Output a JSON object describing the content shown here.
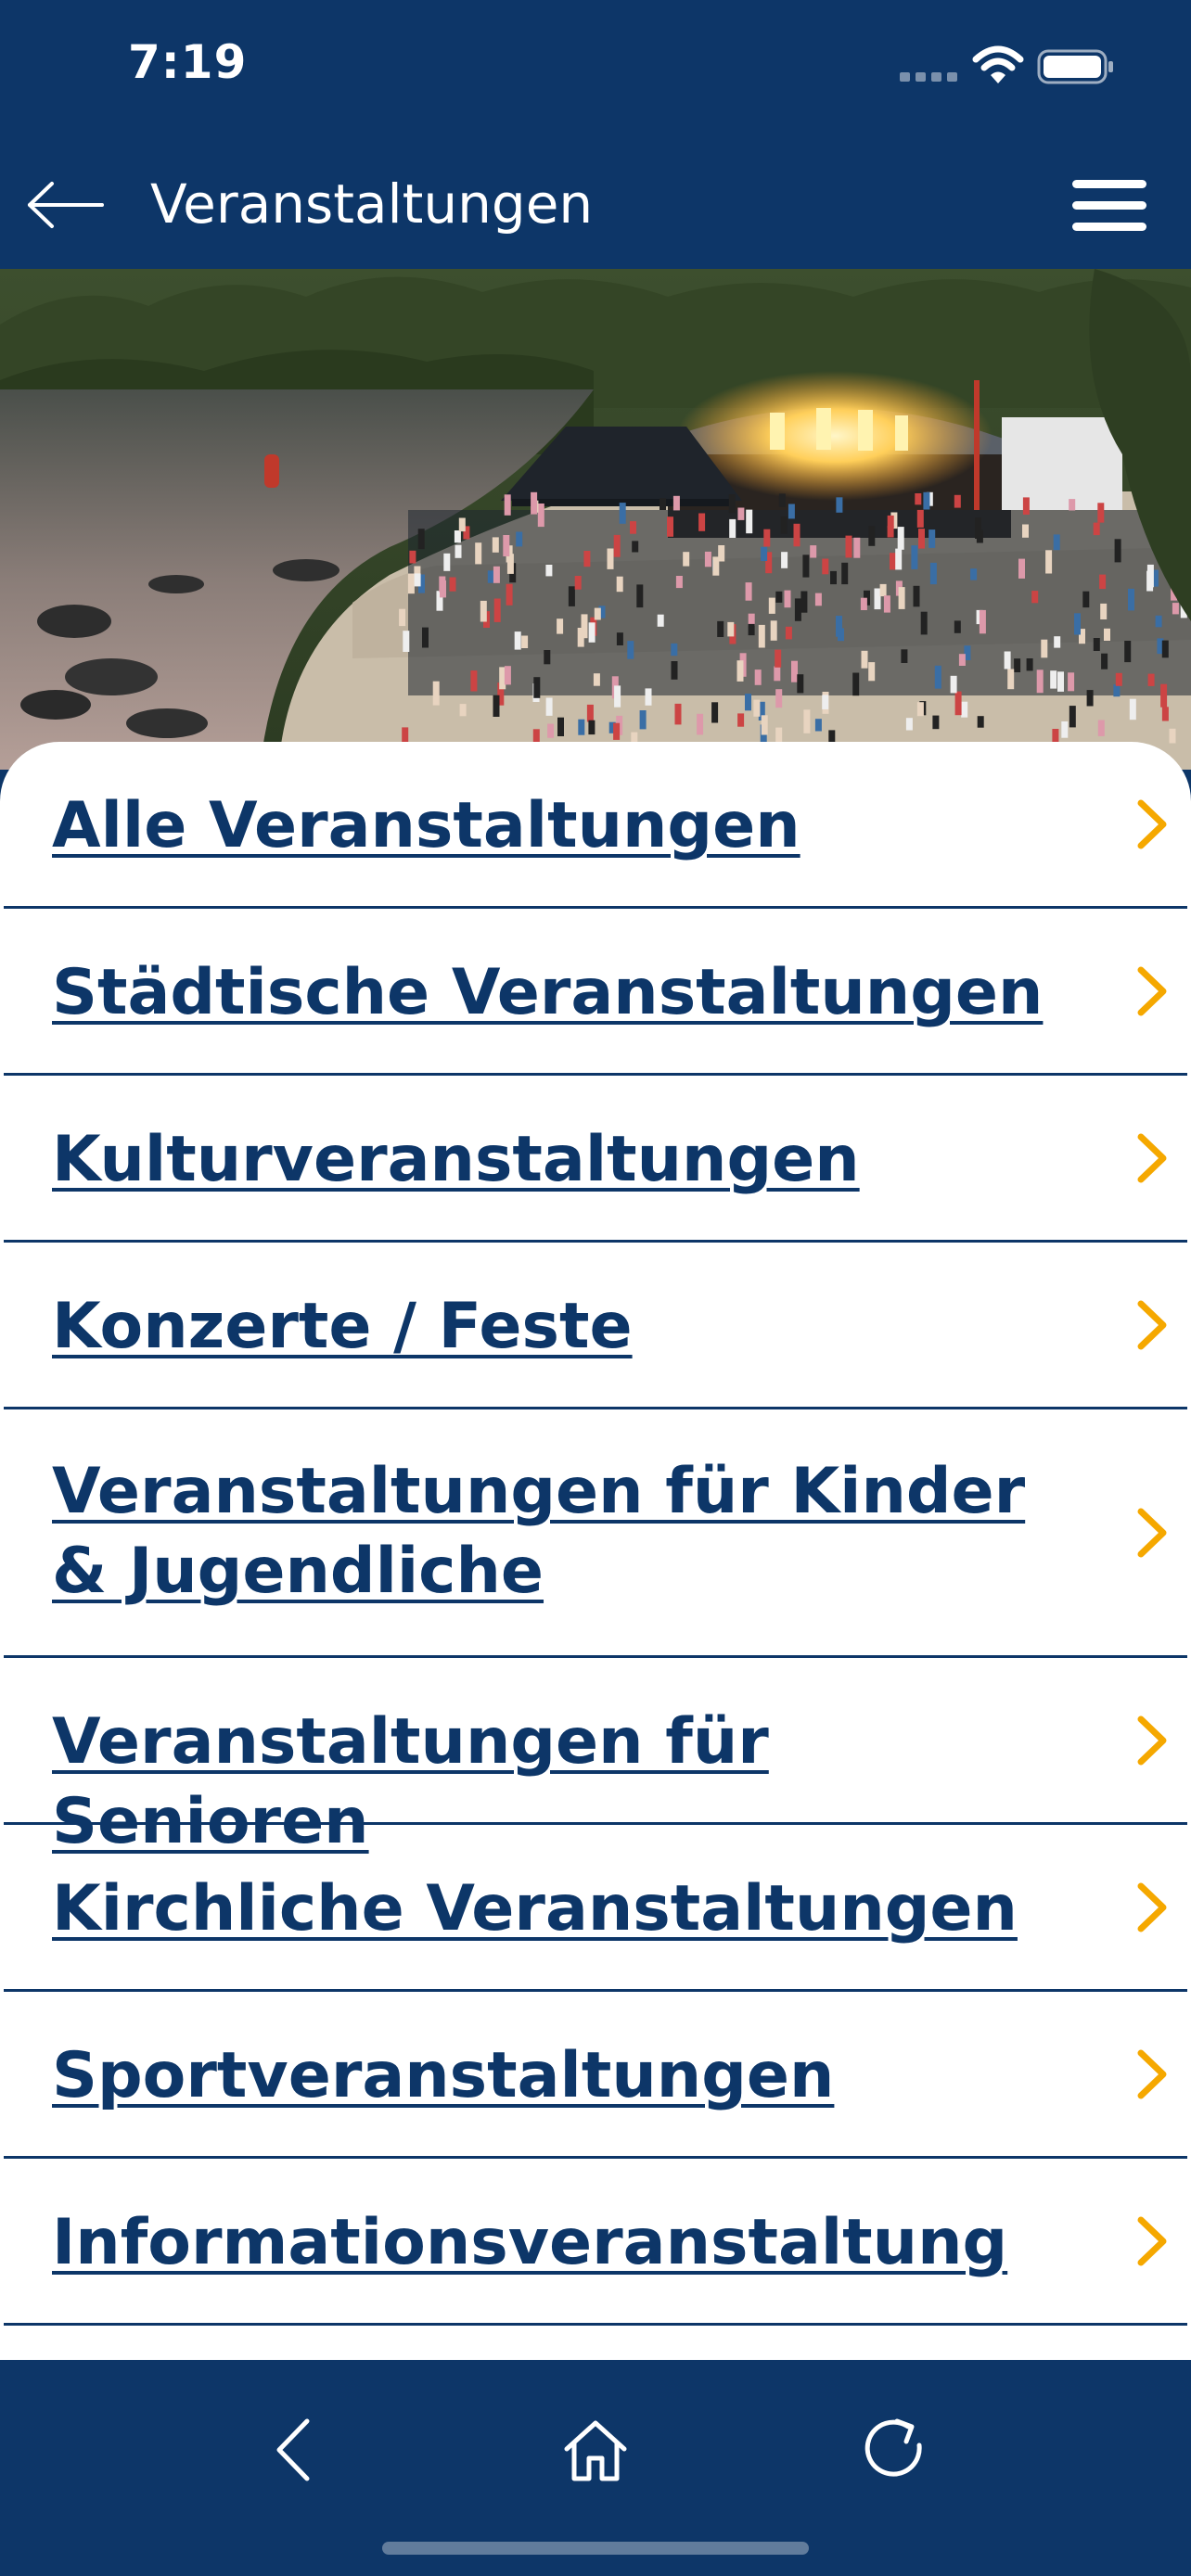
{
  "status_bar": {
    "time": "7:19"
  },
  "header": {
    "title": "Veranstaltungen",
    "back_icon": "arrow-left-icon",
    "menu_icon": "hamburger-menu-icon"
  },
  "hero": {
    "icon": "event-photo"
  },
  "menu": {
    "items": [
      {
        "label": "Alle Veranstaltungen"
      },
      {
        "label": "Städtische Veranstaltungen"
      },
      {
        "label": "Kulturveranstaltungen"
      },
      {
        "label": "Konzerte / Feste"
      },
      {
        "label": "Veranstaltungen für Kinder & Jugendliche"
      },
      {
        "label": "Veranstaltungen für Senioren"
      },
      {
        "label": "Kirchliche Veranstaltungen"
      },
      {
        "label": "Sportveranstaltungen"
      },
      {
        "label": "Informationsveranstaltung"
      }
    ]
  },
  "bottom_nav": {
    "back_icon": "chevron-left-icon",
    "home_icon": "home-icon",
    "reload_icon": "reload-icon"
  },
  "colors": {
    "primary": "#0d3668",
    "accent": "#f5a800",
    "background": "#ffffff"
  }
}
